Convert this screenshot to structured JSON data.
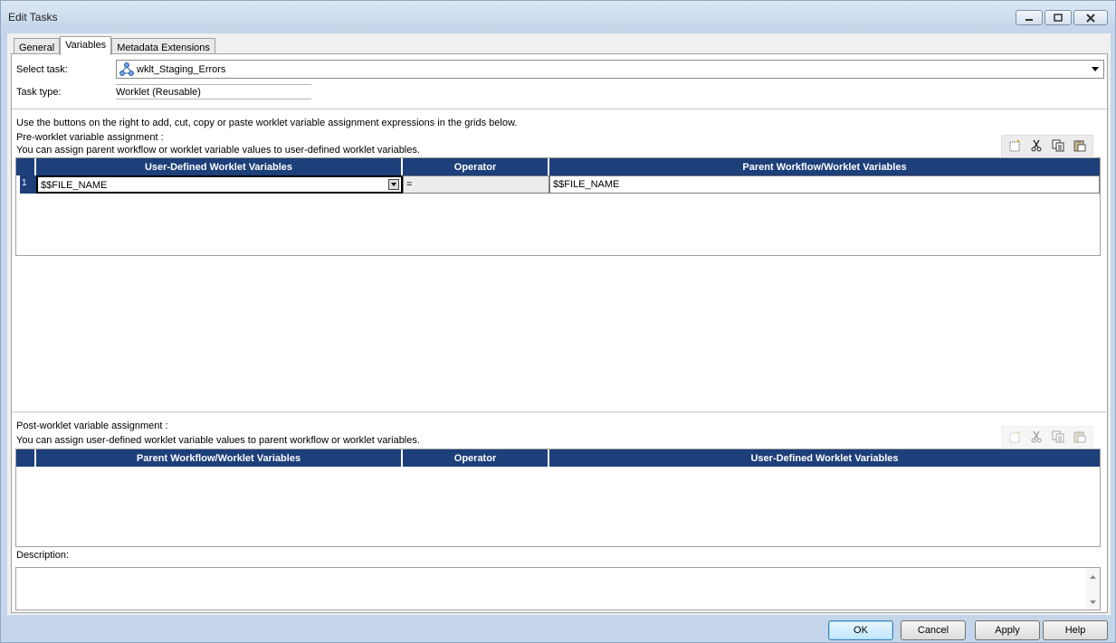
{
  "window": {
    "title": "Edit Tasks"
  },
  "tabs": [
    {
      "label": "General",
      "active": false
    },
    {
      "label": "Variables",
      "active": true
    },
    {
      "label": "Metadata Extensions",
      "active": false
    }
  ],
  "form": {
    "select_task_label": "Select task:",
    "select_task_value": "wklt_Staging_Errors",
    "task_type_label": "Task type:",
    "task_type_value": "Worklet (Reusable)",
    "instructions": "Use the buttons on the right to add, cut, copy or paste worklet variable assignment expressions in the grids below."
  },
  "pre": {
    "title": "Pre-worklet variable assignment :",
    "subtitle": "You can assign parent workflow or worklet variable values to user-defined worklet variables.",
    "columns": [
      "User-Defined Worklet Variables",
      "Operator",
      "Parent Workflow/Worklet Variables"
    ],
    "rows": [
      {
        "num": "1",
        "left": "$$FILE_NAME",
        "op": "=",
        "right": "$$FILE_NAME"
      }
    ]
  },
  "post": {
    "title": "Post-worklet variable assignment :",
    "subtitle": "You can assign user-defined worklet variable values to parent workflow or worklet variables.",
    "columns": [
      "Parent Workflow/Worklet Variables",
      "Operator",
      "User-Defined Worklet Variables"
    ]
  },
  "description": {
    "label": "Description:",
    "value": ""
  },
  "buttons": {
    "ok": "OK",
    "cancel": "Cancel",
    "apply": "Apply",
    "help": "Help"
  },
  "colors": {
    "grid_header": "#1d3f7a",
    "window_frame": "#c5d6ea"
  },
  "icons": [
    "worklet-icon",
    "dropdown-arrow-icon",
    "new-icon",
    "cut-icon",
    "copy-icon",
    "paste-icon",
    "minimize-icon",
    "maximize-icon",
    "close-icon"
  ]
}
